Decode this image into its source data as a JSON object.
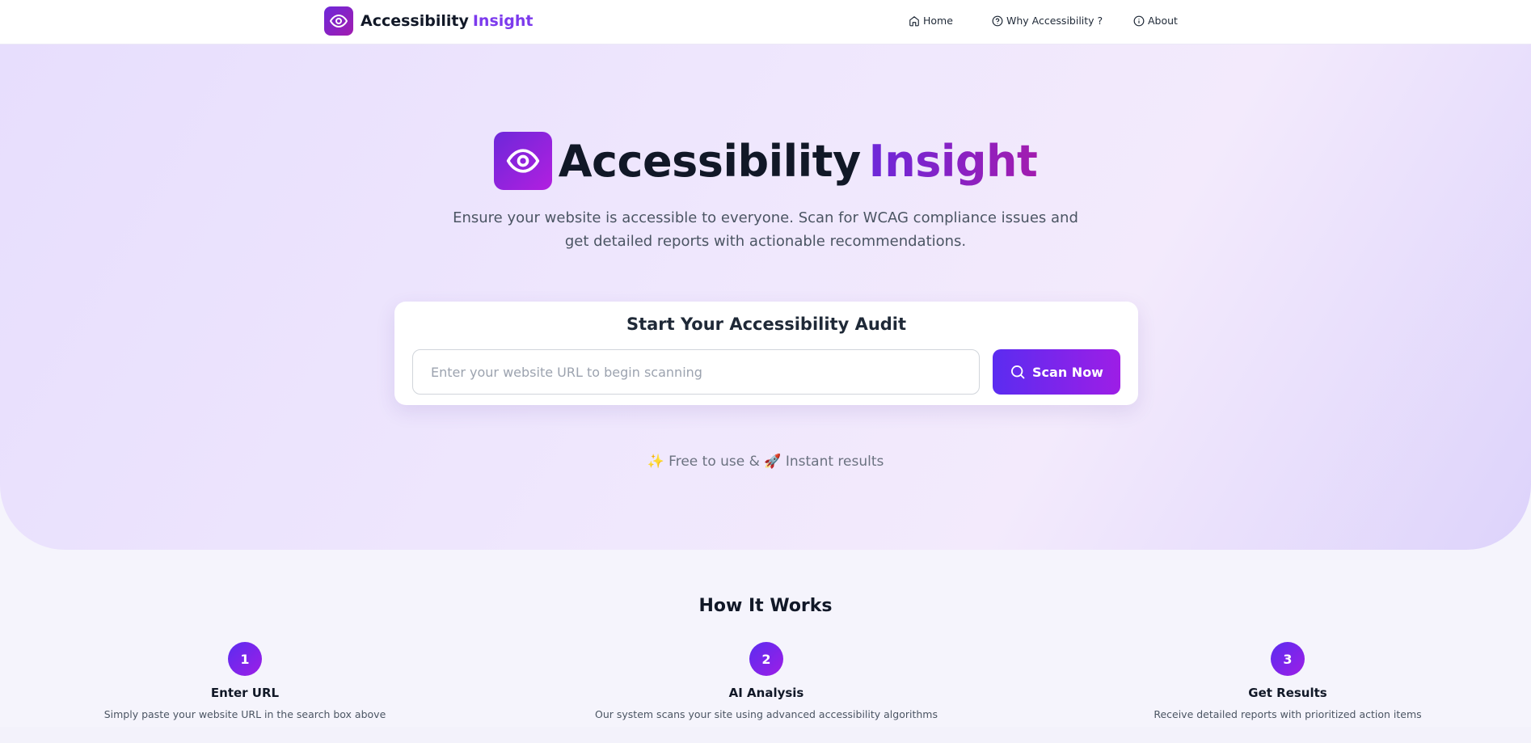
{
  "colors": {
    "accent": "#7c3aed",
    "gradient_start": "#5b2cf0",
    "gradient_end": "#9d1ee6"
  },
  "nav": {
    "brand_main": "Accessibility",
    "brand_accent": "Insight",
    "brand_icon": "eye-icon",
    "items": [
      {
        "label": "Home",
        "icon": "home-icon"
      },
      {
        "label": "Why Accessibility ?",
        "icon": "help-circle-icon"
      },
      {
        "label": "About",
        "icon": "info-icon"
      }
    ]
  },
  "hero": {
    "title_main": "Accessibility",
    "title_accent": "Insight",
    "subtitle": "Ensure your website is accessible to everyone. Scan for WCAG compliance issues and get detailed reports with actionable recommendations.",
    "audit": {
      "title": "Start Your Accessibility Audit",
      "input_placeholder": "Enter your website URL to begin scanning",
      "input_value": "",
      "button_label": "Scan Now"
    },
    "tagline": "✨ Free to use & 🚀 Instant results"
  },
  "how": {
    "title": "How It Works",
    "steps": [
      {
        "num": "1",
        "title": "Enter URL",
        "desc": "Simply paste your website URL in the search box above"
      },
      {
        "num": "2",
        "title": "AI Analysis",
        "desc": "Our system scans your site using advanced accessibility algorithms"
      },
      {
        "num": "3",
        "title": "Get Results",
        "desc": "Receive detailed reports with prioritized action items"
      }
    ]
  }
}
